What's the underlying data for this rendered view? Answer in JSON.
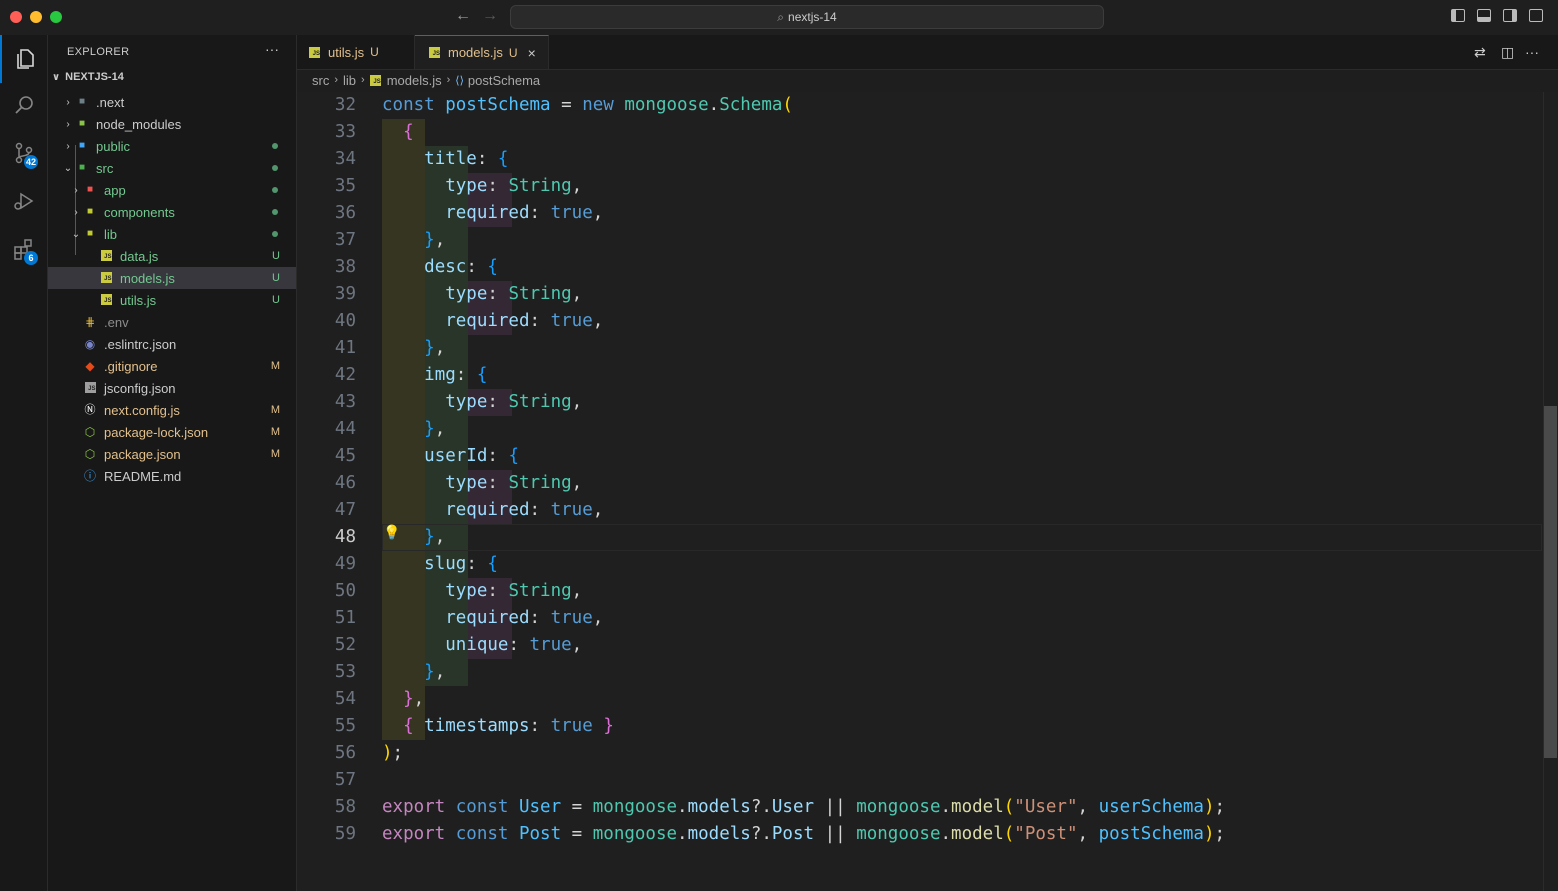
{
  "window": {
    "search_text": "nextjs-14"
  },
  "activity_bar": {
    "source_control_badge": "42",
    "extensions_badge": "6"
  },
  "explorer": {
    "title": "EXPLORER",
    "more": "···",
    "root": "NEXTJS-14",
    "items": [
      {
        "name": ".next",
        "status": "",
        "color": "#cccccc"
      },
      {
        "name": "node_modules",
        "status": "",
        "color": "#cccccc"
      },
      {
        "name": "public",
        "status": "",
        "color": "#73c991"
      },
      {
        "name": "src",
        "status": "",
        "color": "#73c991"
      },
      {
        "name": "app",
        "status": "",
        "color": "#73c991"
      },
      {
        "name": "components",
        "status": "",
        "color": "#73c991"
      },
      {
        "name": "lib",
        "status": "",
        "color": "#73c991"
      },
      {
        "name": "data.js",
        "status": "U",
        "color": "#73c991"
      },
      {
        "name": "models.js",
        "status": "U",
        "color": "#73c991"
      },
      {
        "name": "utils.js",
        "status": "U",
        "color": "#73c991"
      },
      {
        "name": ".env",
        "status": "",
        "color": "#8c8c8c"
      },
      {
        "name": ".eslintrc.json",
        "status": "",
        "color": "#cccccc"
      },
      {
        "name": ".gitignore",
        "status": "M",
        "color": "#e2c08d"
      },
      {
        "name": "jsconfig.json",
        "status": "",
        "color": "#cccccc"
      },
      {
        "name": "next.config.js",
        "status": "M",
        "color": "#e2c08d"
      },
      {
        "name": "package-lock.json",
        "status": "M",
        "color": "#e2c08d"
      },
      {
        "name": "package.json",
        "status": "M",
        "color": "#e2c08d"
      },
      {
        "name": "README.md",
        "status": "",
        "color": "#cccccc"
      }
    ]
  },
  "tabs": [
    {
      "label": "utils.js",
      "status": "U"
    },
    {
      "label": "models.js",
      "status": "U",
      "close": "×"
    }
  ],
  "breadcrumb": {
    "parts": [
      "src",
      "lib",
      "models.js",
      "postSchema"
    ]
  },
  "editor": {
    "current_line": "48",
    "lines": [
      {
        "n": "32",
        "t": [
          [
            "kw",
            "const "
          ],
          [
            "var",
            "postSchema"
          ],
          [
            "plain",
            " = "
          ],
          [
            "kw",
            "new "
          ],
          [
            "cls",
            "mongoose"
          ],
          [
            "plain",
            "."
          ],
          [
            "cls",
            "Schema"
          ],
          [
            "b1",
            "("
          ]
        ]
      },
      {
        "n": "33",
        "t": [
          [
            "plain",
            "  "
          ],
          [
            "b2",
            "{"
          ]
        ]
      },
      {
        "n": "34",
        "t": [
          [
            "plain",
            "    "
          ],
          [
            "prop",
            "title"
          ],
          [
            "plain",
            ": "
          ],
          [
            "b3",
            "{"
          ]
        ]
      },
      {
        "n": "35",
        "t": [
          [
            "plain",
            "      "
          ],
          [
            "prop",
            "type"
          ],
          [
            "plain",
            ": "
          ],
          [
            "cls",
            "String"
          ],
          [
            "plain",
            ","
          ]
        ]
      },
      {
        "n": "36",
        "t": [
          [
            "plain",
            "      "
          ],
          [
            "prop",
            "required"
          ],
          [
            "plain",
            ": "
          ],
          [
            "kw",
            "true"
          ],
          [
            "plain",
            ","
          ]
        ]
      },
      {
        "n": "37",
        "t": [
          [
            "plain",
            "    "
          ],
          [
            "b3",
            "}"
          ],
          [
            "plain",
            ","
          ]
        ]
      },
      {
        "n": "38",
        "t": [
          [
            "plain",
            "    "
          ],
          [
            "prop",
            "desc"
          ],
          [
            "plain",
            ": "
          ],
          [
            "b3",
            "{"
          ]
        ]
      },
      {
        "n": "39",
        "t": [
          [
            "plain",
            "      "
          ],
          [
            "prop",
            "type"
          ],
          [
            "plain",
            ": "
          ],
          [
            "cls",
            "String"
          ],
          [
            "plain",
            ","
          ]
        ]
      },
      {
        "n": "40",
        "t": [
          [
            "plain",
            "      "
          ],
          [
            "prop",
            "required"
          ],
          [
            "plain",
            ": "
          ],
          [
            "kw",
            "true"
          ],
          [
            "plain",
            ","
          ]
        ]
      },
      {
        "n": "41",
        "t": [
          [
            "plain",
            "    "
          ],
          [
            "b3",
            "}"
          ],
          [
            "plain",
            ","
          ]
        ]
      },
      {
        "n": "42",
        "t": [
          [
            "plain",
            "    "
          ],
          [
            "prop",
            "img"
          ],
          [
            "plain",
            ": "
          ],
          [
            "b3",
            "{"
          ]
        ]
      },
      {
        "n": "43",
        "t": [
          [
            "plain",
            "      "
          ],
          [
            "prop",
            "type"
          ],
          [
            "plain",
            ": "
          ],
          [
            "cls",
            "String"
          ],
          [
            "plain",
            ","
          ]
        ]
      },
      {
        "n": "44",
        "t": [
          [
            "plain",
            "    "
          ],
          [
            "b3",
            "}"
          ],
          [
            "plain",
            ","
          ]
        ]
      },
      {
        "n": "45",
        "t": [
          [
            "plain",
            "    "
          ],
          [
            "prop",
            "userId"
          ],
          [
            "plain",
            ": "
          ],
          [
            "b3",
            "{"
          ]
        ]
      },
      {
        "n": "46",
        "t": [
          [
            "plain",
            "      "
          ],
          [
            "prop",
            "type"
          ],
          [
            "plain",
            ": "
          ],
          [
            "cls",
            "String"
          ],
          [
            "plain",
            ","
          ]
        ]
      },
      {
        "n": "47",
        "t": [
          [
            "plain",
            "      "
          ],
          [
            "prop",
            "required"
          ],
          [
            "plain",
            ": "
          ],
          [
            "kw",
            "true"
          ],
          [
            "plain",
            ","
          ]
        ]
      },
      {
        "n": "48",
        "t": [
          [
            "plain",
            "    "
          ],
          [
            "b3",
            "}"
          ],
          [
            "plain",
            ","
          ]
        ]
      },
      {
        "n": "49",
        "t": [
          [
            "plain",
            "    "
          ],
          [
            "prop",
            "slug"
          ],
          [
            "plain",
            ": "
          ],
          [
            "b3",
            "{"
          ]
        ]
      },
      {
        "n": "50",
        "t": [
          [
            "plain",
            "      "
          ],
          [
            "prop",
            "type"
          ],
          [
            "plain",
            ": "
          ],
          [
            "cls",
            "String"
          ],
          [
            "plain",
            ","
          ]
        ]
      },
      {
        "n": "51",
        "t": [
          [
            "plain",
            "      "
          ],
          [
            "prop",
            "required"
          ],
          [
            "plain",
            ": "
          ],
          [
            "kw",
            "true"
          ],
          [
            "plain",
            ","
          ]
        ]
      },
      {
        "n": "52",
        "t": [
          [
            "plain",
            "      "
          ],
          [
            "prop",
            "unique"
          ],
          [
            "plain",
            ": "
          ],
          [
            "kw",
            "true"
          ],
          [
            "plain",
            ","
          ]
        ]
      },
      {
        "n": "53",
        "t": [
          [
            "plain",
            "    "
          ],
          [
            "b3",
            "}"
          ],
          [
            "plain",
            ","
          ]
        ]
      },
      {
        "n": "54",
        "t": [
          [
            "plain",
            "  "
          ],
          [
            "b2",
            "}"
          ],
          [
            "plain",
            ","
          ]
        ]
      },
      {
        "n": "55",
        "t": [
          [
            "plain",
            "  "
          ],
          [
            "b2",
            "{"
          ],
          [
            "plain",
            " "
          ],
          [
            "prop",
            "timestamps"
          ],
          [
            "plain",
            ": "
          ],
          [
            "kw",
            "true"
          ],
          [
            "plain",
            " "
          ],
          [
            "b2",
            "}"
          ]
        ]
      },
      {
        "n": "56",
        "t": [
          [
            "b1",
            ")"
          ],
          [
            "plain",
            ";"
          ]
        ]
      },
      {
        "n": "57",
        "t": []
      },
      {
        "n": "58",
        "t": [
          [
            "kw2",
            "export "
          ],
          [
            "kw",
            "const "
          ],
          [
            "var",
            "User"
          ],
          [
            "plain",
            " = "
          ],
          [
            "cls",
            "mongoose"
          ],
          [
            "plain",
            "."
          ],
          [
            "prop",
            "models"
          ],
          [
            "plain",
            "?."
          ],
          [
            "prop",
            "User"
          ],
          [
            "plain",
            " || "
          ],
          [
            "cls",
            "mongoose"
          ],
          [
            "plain",
            "."
          ],
          [
            "fn",
            "model"
          ],
          [
            "b1",
            "("
          ],
          [
            "str",
            "\"User\""
          ],
          [
            "plain",
            ", "
          ],
          [
            "var",
            "userSchema"
          ],
          [
            "b1",
            ")"
          ],
          [
            "plain",
            ";"
          ]
        ]
      },
      {
        "n": "59",
        "t": [
          [
            "kw2",
            "export "
          ],
          [
            "kw",
            "const "
          ],
          [
            "var",
            "Post"
          ],
          [
            "plain",
            " = "
          ],
          [
            "cls",
            "mongoose"
          ],
          [
            "plain",
            "."
          ],
          [
            "prop",
            "models"
          ],
          [
            "plain",
            "?."
          ],
          [
            "prop",
            "Post"
          ],
          [
            "plain",
            " || "
          ],
          [
            "cls",
            "mongoose"
          ],
          [
            "plain",
            "."
          ],
          [
            "fn",
            "model"
          ],
          [
            "b1",
            "("
          ],
          [
            "str",
            "\"Post\""
          ],
          [
            "plain",
            ", "
          ],
          [
            "var",
            "postSchema"
          ],
          [
            "b1",
            ")"
          ],
          [
            "plain",
            ";"
          ]
        ]
      }
    ]
  }
}
